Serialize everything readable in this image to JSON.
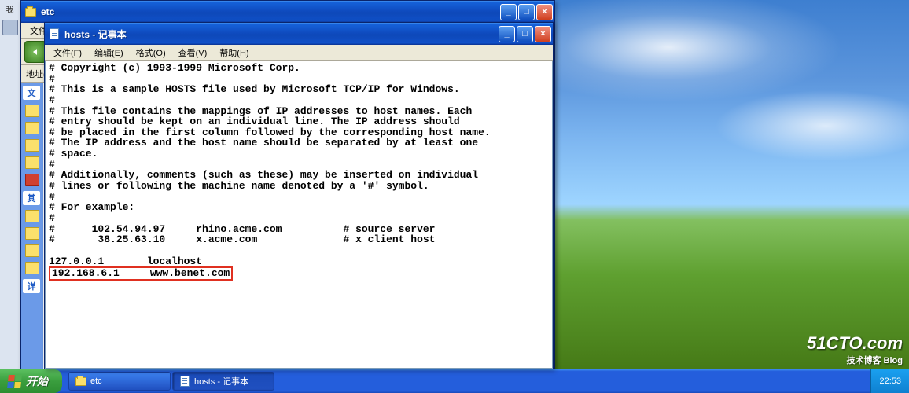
{
  "desktop": {
    "left_label": "我"
  },
  "etc_window": {
    "title": "etc",
    "menus": [
      "文件("
    ],
    "addr_label": "地址("
  },
  "sidebar_headers": [
    "文",
    "其",
    "详"
  ],
  "notepad_window": {
    "title": "hosts - 记事本",
    "menus": {
      "file": "文件(F)",
      "edit": "编辑(E)",
      "format": "格式(O)",
      "view": "查看(V)",
      "help": "帮助(H)"
    }
  },
  "hosts_content": {
    "lines": [
      "# Copyright (c) 1993-1999 Microsoft Corp.",
      "#",
      "# This is a sample HOSTS file used by Microsoft TCP/IP for Windows.",
      "#",
      "# This file contains the mappings of IP addresses to host names. Each",
      "# entry should be kept on an individual line. The IP address should",
      "# be placed in the first column followed by the corresponding host name.",
      "# The IP address and the host name should be separated by at least one",
      "# space.",
      "#",
      "# Additionally, comments (such as these) may be inserted on individual",
      "# lines or following the machine name denoted by a '#' symbol.",
      "#",
      "# For example:",
      "#",
      "#      102.54.94.97     rhino.acme.com          # source server",
      "#       38.25.63.10     x.acme.com              # x client host",
      "",
      "127.0.0.1       localhost"
    ],
    "highlighted_line": "192.168.6.1     www.benet.com"
  },
  "taskbar": {
    "start_label": "开始",
    "items": [
      {
        "label": "etc",
        "icon": "folder"
      },
      {
        "label": "hosts - 记事本",
        "icon": "notepad"
      }
    ],
    "clock": "22:53"
  },
  "watermark": {
    "main": "51CTO.com",
    "sub": "技术博客  Blog"
  }
}
